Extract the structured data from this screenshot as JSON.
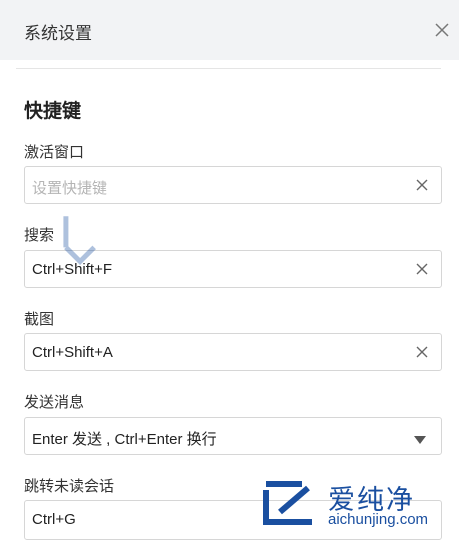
{
  "window": {
    "title": "系统设置"
  },
  "section": {
    "title": "快捷键"
  },
  "fields": [
    {
      "label": "激活窗口",
      "value": "设置快捷键",
      "is_placeholder": true,
      "type": "shortcut"
    },
    {
      "label": "搜索",
      "value": "Ctrl+Shift+F",
      "is_placeholder": false,
      "type": "shortcut"
    },
    {
      "label": "截图",
      "value": "Ctrl+Shift+A",
      "is_placeholder": false,
      "type": "shortcut"
    },
    {
      "label": "发送消息",
      "value": "Enter 发送 , Ctrl+Enter 换行",
      "is_placeholder": false,
      "type": "select"
    },
    {
      "label": "跳转未读会话",
      "value": "Ctrl+G",
      "is_placeholder": false,
      "type": "shortcut"
    }
  ],
  "watermark": {
    "brand": "爱纯净",
    "url": "aichunjing.com"
  },
  "icons": {
    "close": "close-icon",
    "clear": "clear-icon",
    "dropdown": "caret-down-icon"
  },
  "colors": {
    "titlebar_bg": "#f2f3f5",
    "border": "#d6d6d6",
    "watermark": "#1a4fa0"
  }
}
